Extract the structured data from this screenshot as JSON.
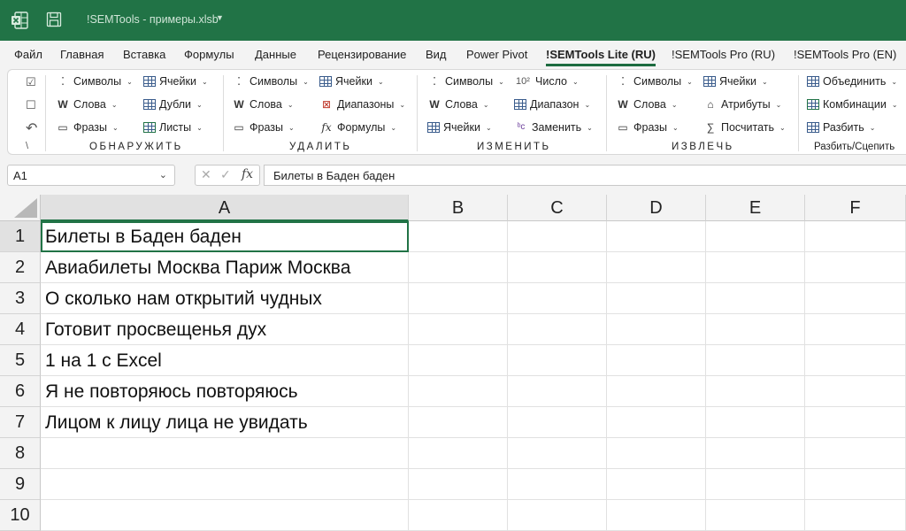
{
  "window": {
    "title": "!SEMTools - примеры.xlsb",
    "app_icon": "excel-icon",
    "accent": "#217346"
  },
  "tabs": [
    {
      "label": "Файл"
    },
    {
      "label": "Главная"
    },
    {
      "label": "Вставка"
    },
    {
      "label": "Формулы"
    },
    {
      "label": "Данные"
    },
    {
      "label": "Рецензирование"
    },
    {
      "label": "Вид"
    },
    {
      "label": "Power Pivot"
    },
    {
      "label": "!SEMTools Lite (RU)",
      "active": true
    },
    {
      "label": "!SEMTools Pro (RU)"
    },
    {
      "label": "!SEMTools Pro (EN)"
    }
  ],
  "ribbon": {
    "quick": {
      "undo_symbol": "\\"
    },
    "groups": [
      {
        "label": "ОБНАРУЖИТЬ",
        "items": [
          "Символы",
          "Ячейки",
          "Слова",
          "Дубли",
          "Фразы",
          "Листы"
        ]
      },
      {
        "label": "УДАЛИТЬ",
        "items": [
          "Символы",
          "Ячейки",
          "Слова",
          "Диапазоны",
          "Фразы",
          "Формулы"
        ]
      },
      {
        "label": "ИЗМЕНИТЬ",
        "items": [
          "Символы",
          "Число",
          "Слова",
          "Диапазон",
          "Ячейки",
          "Заменить"
        ]
      },
      {
        "label": "ИЗВЛЕЧЬ",
        "items": [
          "Символы",
          "Ячейки",
          "Слова",
          "Атрибуты",
          "Фразы",
          "Посчитать"
        ]
      },
      {
        "label": "Разбить/Сцепить",
        "items": [
          "Объединить",
          "Комбинации",
          "Разбить"
        ]
      }
    ],
    "number_icon": "10²"
  },
  "formula_bar": {
    "name_box": "A1",
    "formula": "Билеты в Баден баден",
    "fx_label": "fx"
  },
  "sheet": {
    "columns": [
      "A",
      "B",
      "C",
      "D",
      "E",
      "F"
    ],
    "rows": [
      "1",
      "2",
      "3",
      "4",
      "5",
      "6",
      "7",
      "8",
      "9",
      "10"
    ],
    "column_a": [
      "Билеты в Баден баден",
      "Авиабилеты Москва Париж Москва",
      "О сколько нам открытий чудных",
      "Готовит просвещенья дух",
      "1 на 1 с Excel",
      "Я не повторяюсь повторяюсь",
      "Лицом к лицу лица не увидать",
      "",
      "",
      ""
    ],
    "active_cell": "A1"
  }
}
